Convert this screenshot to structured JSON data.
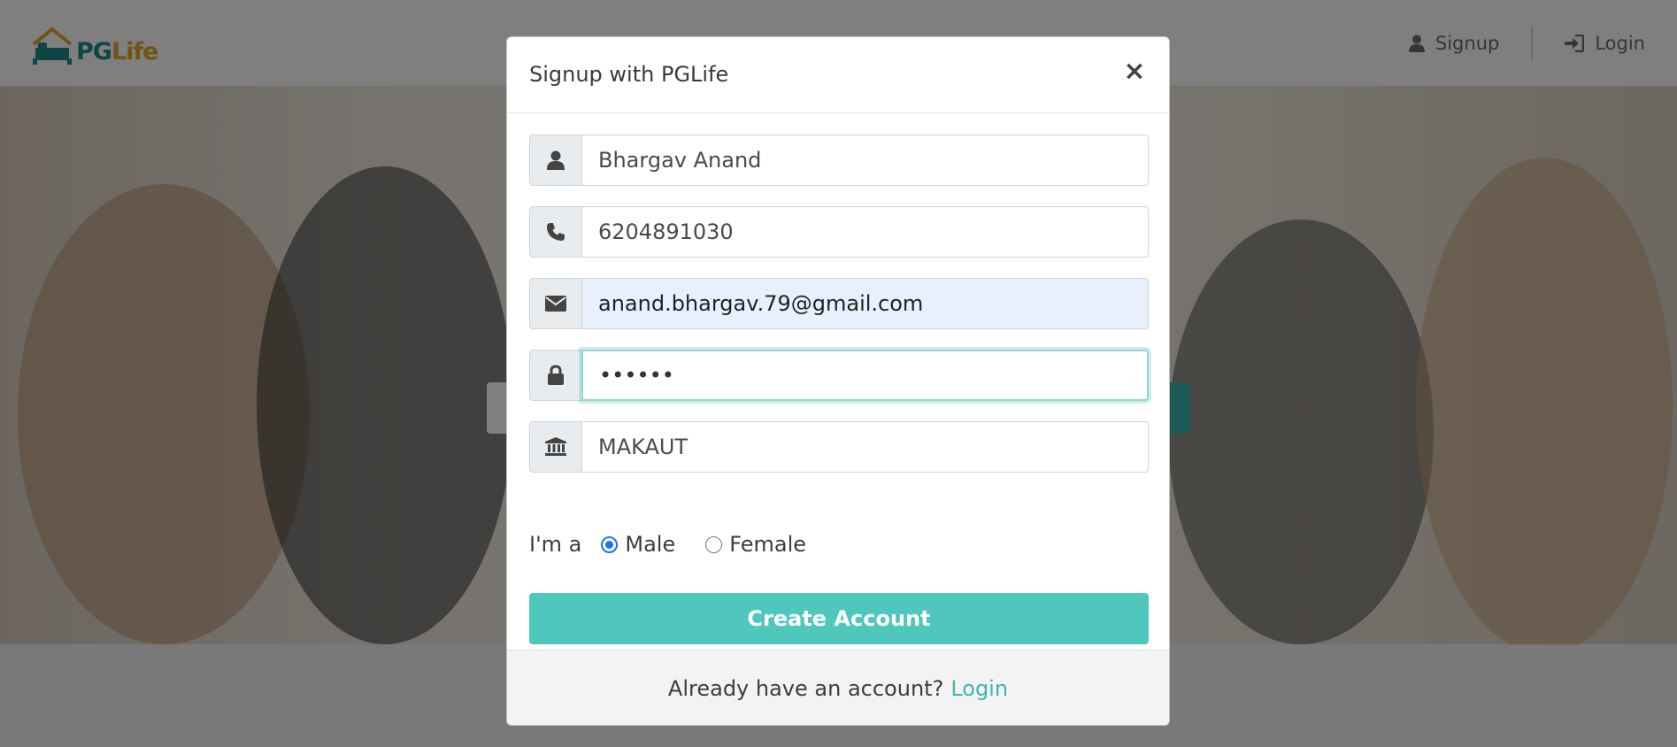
{
  "navbar": {
    "logo_pg": "PG",
    "logo_life": "Life",
    "signup_label": "Signup",
    "login_label": "Login"
  },
  "modal": {
    "title": "Signup with PGLife",
    "close_label": "×",
    "fields": {
      "full_name": "Bhargav Anand",
      "phone": "6204891030",
      "email": "anand.bhargav.79@gmail.com",
      "password": "••••••",
      "college": "MAKAUT"
    },
    "gender": {
      "label": "I'm a",
      "options": [
        "Male",
        "Female"
      ],
      "selected": "Male"
    },
    "submit_label": "Create Account",
    "footer_text": "Already have an account?",
    "footer_link": "Login"
  },
  "colors": {
    "brand_teal": "#4fc7bc",
    "logo_teal": "#1f8a8a",
    "logo_gold": "#e4a72c",
    "radio_blue": "#1a73e8"
  },
  "icons": {
    "name": "user-icon",
    "phone": "phone-icon",
    "email": "envelope-icon",
    "password": "lock-icon",
    "college": "university-icon",
    "signup": "user-icon",
    "login": "sign-in-icon",
    "close": "close-icon"
  }
}
